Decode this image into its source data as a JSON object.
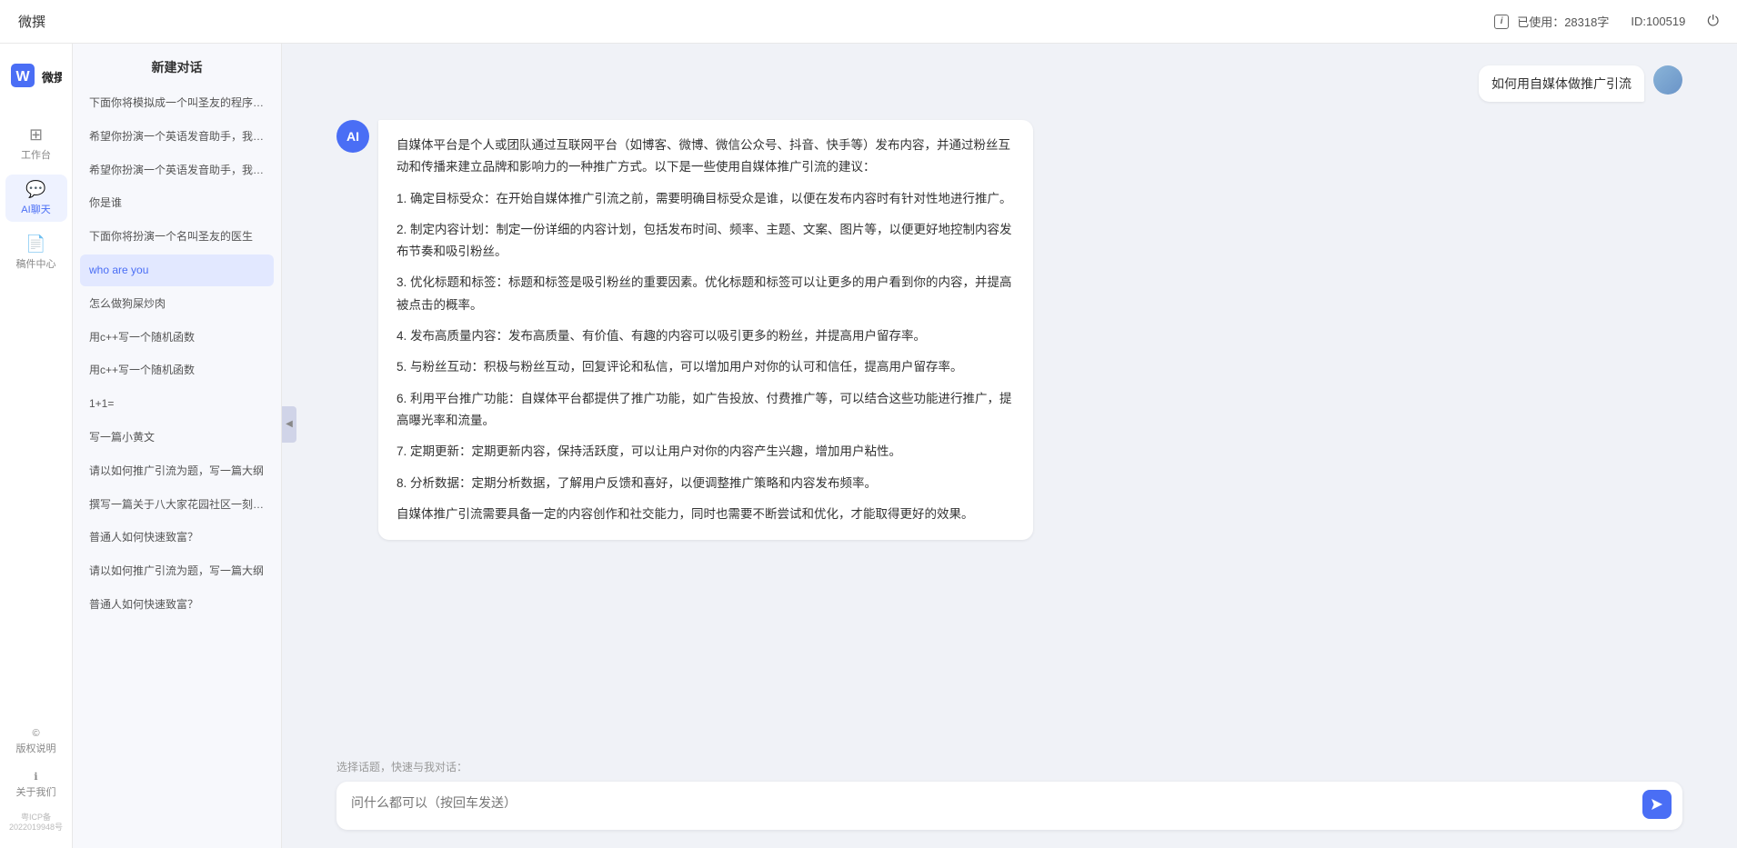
{
  "topbar": {
    "title": "微撰",
    "char_count_label": "已使用：28318字",
    "id_label": "ID:100519",
    "logout_icon": "⏻"
  },
  "left_nav": {
    "logo_text": "微撰",
    "items": [
      {
        "id": "workbench",
        "label": "工作台",
        "icon": "⊞",
        "active": false
      },
      {
        "id": "ai-chat",
        "label": "AI聊天",
        "icon": "💬",
        "active": true
      },
      {
        "id": "drafts",
        "label": "稿件中心",
        "icon": "📄",
        "active": false
      }
    ],
    "bottom_items": [
      {
        "id": "copyright",
        "label": "版权说明",
        "icon": "©"
      },
      {
        "id": "about",
        "label": "关于我们",
        "icon": "ℹ"
      }
    ],
    "beian": "粤ICP备2022019948号"
  },
  "sidebar": {
    "new_chat_label": "新建对话",
    "items": [
      {
        "id": 1,
        "text": "下面你将模拟成一个叫圣友的程序员、我说...",
        "active": false
      },
      {
        "id": 2,
        "text": "希望你扮演一个英语发音助手，我提供给你...",
        "active": false
      },
      {
        "id": 3,
        "text": "希望你扮演一个英语发音助手，我提供给你...",
        "active": false
      },
      {
        "id": 4,
        "text": "你是谁",
        "active": false
      },
      {
        "id": 5,
        "text": "下面你将扮演一个名叫圣友的医生",
        "active": false
      },
      {
        "id": 6,
        "text": "who are you",
        "active": true
      },
      {
        "id": 7,
        "text": "怎么做狗屎炒肉",
        "active": false
      },
      {
        "id": 8,
        "text": "用c++写一个随机函数",
        "active": false
      },
      {
        "id": 9,
        "text": "用c++写一个随机函数",
        "active": false
      },
      {
        "id": 10,
        "text": "1+1=",
        "active": false
      },
      {
        "id": 11,
        "text": "写一篇小黄文",
        "active": false
      },
      {
        "id": 12,
        "text": "请以如何推广引流为题，写一篇大纲",
        "active": false
      },
      {
        "id": 13,
        "text": "撰写一篇关于八大家花园社区一刻钟便民生...",
        "active": false
      },
      {
        "id": 14,
        "text": "普通人如何快速致富？",
        "active": false
      },
      {
        "id": 15,
        "text": "请以如何推广引流为题，写一篇大纲",
        "active": false
      },
      {
        "id": 16,
        "text": "普通人如何快速致富？",
        "active": false
      }
    ]
  },
  "chat": {
    "user_message": "如何用自媒体做推广引流",
    "ai_response_paragraphs": [
      "自媒体平台是个人或团队通过互联网平台（如博客、微博、微信公众号、抖音、快手等）发布内容，并通过粉丝互动和传播来建立品牌和影响力的一种推广方式。以下是一些使用自媒体推广引流的建议：",
      "1. 确定目标受众：在开始自媒体推广引流之前，需要明确目标受众是谁，以便在发布内容时有针对性地进行推广。",
      "2. 制定内容计划：制定一份详细的内容计划，包括发布时间、频率、主题、文案、图片等，以便更好地控制内容发布节奏和吸引粉丝。",
      "3. 优化标题和标签：标题和标签是吸引粉丝的重要因素。优化标题和标签可以让更多的用户看到你的内容，并提高被点击的概率。",
      "4. 发布高质量内容：发布高质量、有价值、有趣的内容可以吸引更多的粉丝，并提高用户留存率。",
      "5. 与粉丝互动：积极与粉丝互动，回复评论和私信，可以增加用户对你的认可和信任，提高用户留存率。",
      "6. 利用平台推广功能：自媒体平台都提供了推广功能，如广告投放、付费推广等，可以结合这些功能进行推广，提高曝光率和流量。",
      "7. 定期更新：定期更新内容，保持活跃度，可以让用户对你的内容产生兴趣，增加用户粘性。",
      "8. 分析数据：定期分析数据，了解用户反馈和喜好，以便调整推广策略和内容发布频率。",
      "自媒体推广引流需要具备一定的内容创作和社交能力，同时也需要不断尝试和优化，才能取得更好的效果。"
    ],
    "quick_label": "选择话题，快速与我对话：",
    "input_placeholder": "问什么都可以（按回车发送）"
  }
}
